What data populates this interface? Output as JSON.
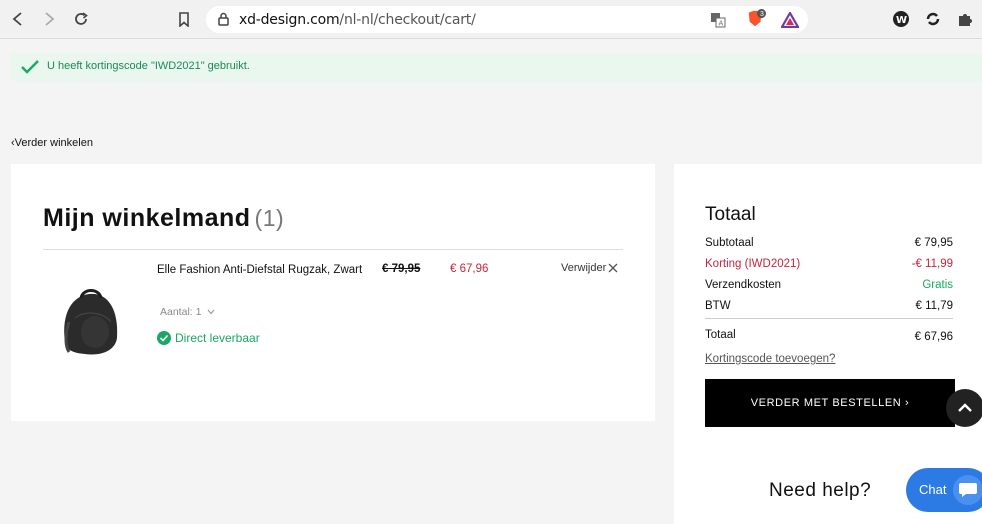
{
  "browser": {
    "url_host": "xd-design.com",
    "url_path": "/nl-nl/checkout/cart/",
    "brave_badge": "3"
  },
  "notice": {
    "text": "U heeft kortingscode \"IWD2021\" gebruikt."
  },
  "back_link": "‹Verder winkelen",
  "cart": {
    "title": "Mijn winkelmand",
    "count": "(1)",
    "item": {
      "name": "Elle Fashion Anti-Diefstal Rugzak, Zwart",
      "old_price": "€ 79,95",
      "new_price": "€ 67,96",
      "remove_label": "Verwijder",
      "qty_label": "Aantal: 1",
      "stock_label": "Direct leverbaar"
    }
  },
  "summary": {
    "title": "Totaal",
    "subtotal_label": "Subtotaal",
    "subtotal_value": "€ 79,95",
    "discount_label": "Korting (IWD2021)",
    "discount_value": "-€ 11,99",
    "shipping_label": "Verzendkosten",
    "shipping_value": "Gratis",
    "vat_label": "BTW",
    "vat_value": "€ 11,79",
    "total_label": "Totaal",
    "total_value": "€ 67,96",
    "coupon_link": "Kortingscode toevoegen?",
    "checkout_label": "VERDER MET BESTELLEN ›"
  },
  "help": {
    "text": "Need help?",
    "chat_label": "Chat"
  },
  "colors": {
    "accent_green": "#1aa865",
    "discount_red": "#c8243f",
    "chat_blue": "#2c7be5"
  }
}
